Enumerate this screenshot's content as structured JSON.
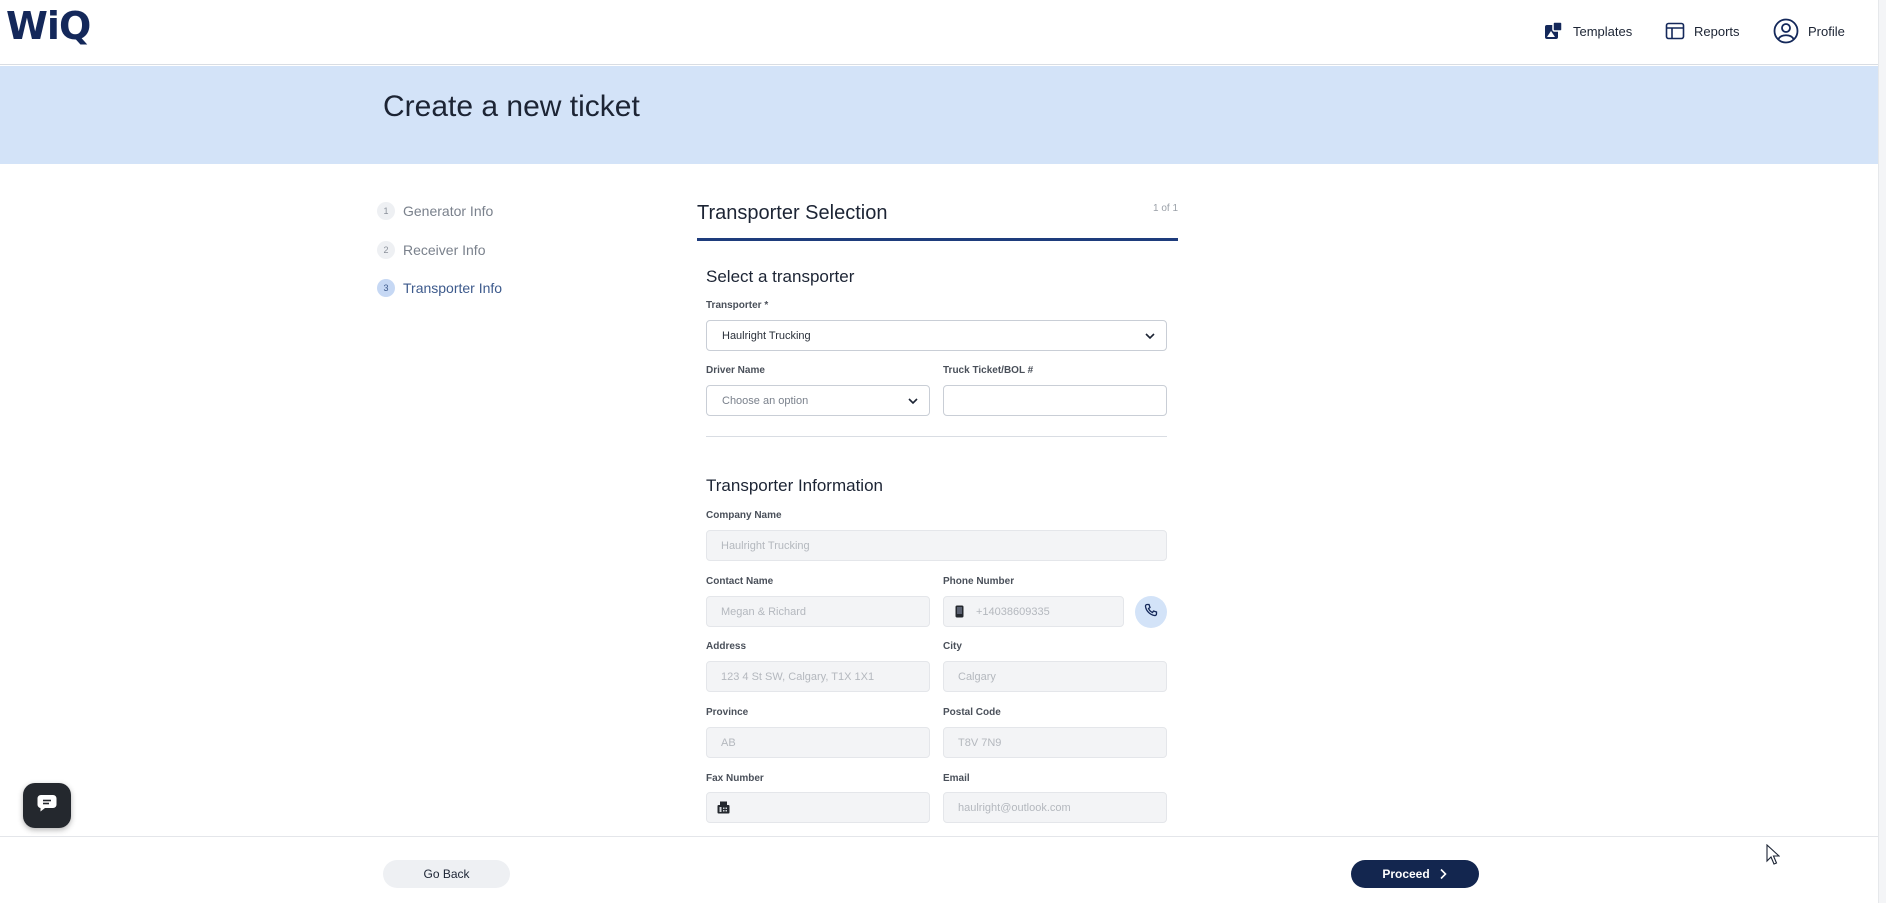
{
  "app": {
    "logo": "WiQ"
  },
  "nav": {
    "templates": {
      "label": "Templates",
      "icon": "templates-icon"
    },
    "reports": {
      "label": "Reports",
      "icon": "reports-icon"
    },
    "profile": {
      "label": "Profile",
      "icon": "profile-icon"
    }
  },
  "page": {
    "title": "Create a new ticket"
  },
  "steps": [
    {
      "num": "1",
      "label": "Generator Info",
      "active": false
    },
    {
      "num": "2",
      "label": "Receiver Info",
      "active": false
    },
    {
      "num": "3",
      "label": "Transporter Info",
      "active": true
    }
  ],
  "section": {
    "title": "Transporter Selection",
    "page_count": "1 of 1"
  },
  "select_transporter": {
    "heading": "Select a transporter",
    "transporter_label": "Transporter *",
    "transporter_value": "Haulright Trucking",
    "driver_label": "Driver Name",
    "driver_placeholder": "Choose an option",
    "ticket_label": "Truck Ticket/BOL #",
    "ticket_value": ""
  },
  "transporter_info": {
    "heading": "Transporter Information",
    "company_label": "Company Name",
    "company_value": "Haulright Trucking",
    "contact_label": "Contact Name",
    "contact_value": "Megan & Richard",
    "phone_label": "Phone Number",
    "phone_value": "+14038609335",
    "address_label": "Address",
    "address_value": "123 4 St SW, Calgary, T1X 1X1",
    "city_label": "City",
    "city_value": "Calgary",
    "province_label": "Province",
    "province_value": "AB",
    "postal_label": "Postal Code",
    "postal_value": "T8V 7N9",
    "fax_label": "Fax Number",
    "fax_value": "",
    "email_label": "Email",
    "email_value": "haulright@outlook.com"
  },
  "footer": {
    "back_label": "Go Back",
    "proceed_label": "Proceed"
  },
  "colors": {
    "brand": "#14285a",
    "band": "#d3e3f8",
    "accent": "#1e3c7c",
    "proceed": "#13264f"
  }
}
